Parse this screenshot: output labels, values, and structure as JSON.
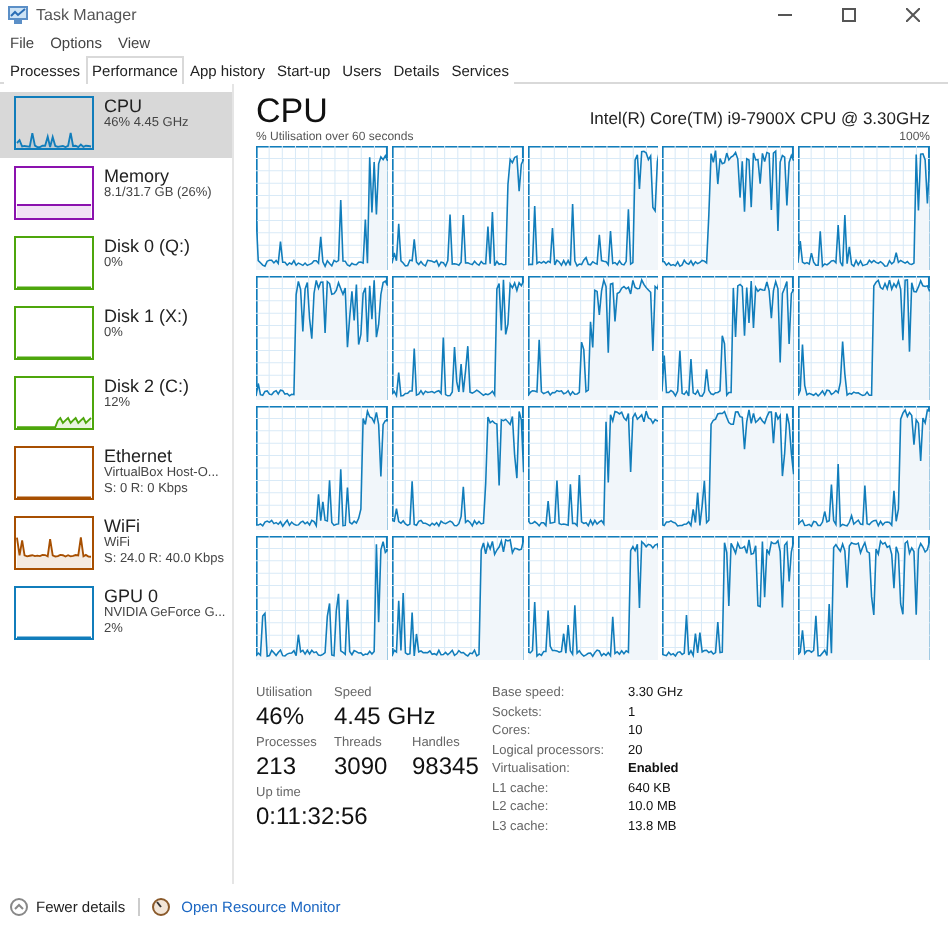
{
  "window": {
    "title": "Task Manager"
  },
  "menu": [
    "File",
    "Options",
    "View"
  ],
  "tabs": [
    {
      "label": "Processes",
      "selected": false
    },
    {
      "label": "Performance",
      "selected": true
    },
    {
      "label": "App history",
      "selected": false
    },
    {
      "label": "Start-up",
      "selected": false
    },
    {
      "label": "Users",
      "selected": false
    },
    {
      "label": "Details",
      "selected": false
    },
    {
      "label": "Services",
      "selected": false
    }
  ],
  "sidebar": {
    "items": [
      {
        "name": "CPU",
        "details": [
          "46% 4.45 GHz"
        ],
        "color": "#117dbb",
        "selected": true
      },
      {
        "name": "Memory",
        "details": [
          "8.1/31.7 GB (26%)"
        ],
        "color": "#8b12ae",
        "selected": false
      },
      {
        "name": "Disk 0 (Q:)",
        "details": [
          "0%"
        ],
        "color": "#4da60c",
        "selected": false
      },
      {
        "name": "Disk 1 (X:)",
        "details": [
          "0%"
        ],
        "color": "#4da60c",
        "selected": false
      },
      {
        "name": "Disk 2 (C:)",
        "details": [
          "12%"
        ],
        "color": "#4da60c",
        "selected": false
      },
      {
        "name": "Ethernet",
        "details": [
          "VirtualBox Host-O...",
          "S: 0 R: 0 Kbps"
        ],
        "color": "#a74f01",
        "selected": false
      },
      {
        "name": "WiFi",
        "details": [
          "WiFi",
          "S: 24.0 R: 40.0 Kbps"
        ],
        "color": "#a74f01",
        "selected": false
      },
      {
        "name": "GPU 0",
        "details": [
          "NVIDIA GeForce G...",
          "2%"
        ],
        "color": "#117dbb",
        "selected": false
      }
    ]
  },
  "header": {
    "title": "CPU",
    "model": "Intel(R) Core(TM) i9-7900X CPU @ 3.30GHz"
  },
  "graph": {
    "caption": "% Utilisation over 60 seconds",
    "max_label": "100%"
  },
  "stats": [
    [
      {
        "label": "Utilisation",
        "value": "46%"
      },
      {
        "label": "Speed",
        "value": "4.45 GHz"
      }
    ],
    [
      {
        "label": "Processes",
        "value": "213"
      },
      {
        "label": "Threads",
        "value": "3090"
      },
      {
        "label": "Handles",
        "value": "98345"
      }
    ],
    [
      {
        "label": "Up time",
        "value": "0:11:32:56"
      }
    ]
  ],
  "specs": [
    {
      "label": "Base speed:",
      "value": "3.30 GHz",
      "emphasis": false
    },
    {
      "label": "Sockets:",
      "value": "1",
      "emphasis": false
    },
    {
      "label": "Cores:",
      "value": "10",
      "emphasis": false
    },
    {
      "label": "Logical processors:",
      "value": "20",
      "emphasis": false
    },
    {
      "label": "Virtualisation:",
      "value": "Enabled",
      "emphasis": true
    },
    {
      "label": "L1 cache:",
      "value": "640 KB",
      "emphasis": false
    },
    {
      "label": "L2 cache:",
      "value": "10.0 MB",
      "emphasis": false
    },
    {
      "label": "L3 cache:",
      "value": "13.8 MB",
      "emphasis": false
    }
  ],
  "footer": {
    "fewer": "Fewer details",
    "monitor": "Open Resource Monitor"
  }
}
